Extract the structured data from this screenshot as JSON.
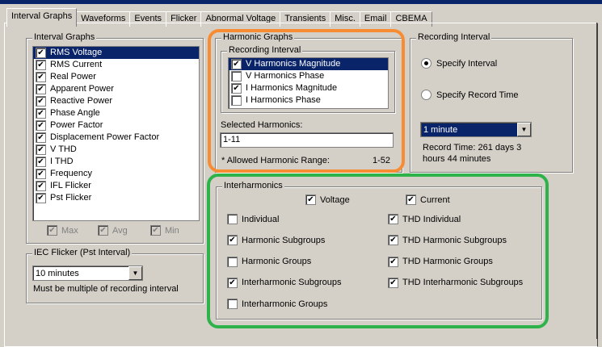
{
  "tabs": [
    "Interval Graphs",
    "Waveforms",
    "Events",
    "Flicker",
    "Abnormal Voltage",
    "Transients",
    "Misc.",
    "Email",
    "CBEMA"
  ],
  "interval_graphs": {
    "title": "Interval Graphs",
    "items": [
      {
        "label": "RMS Voltage",
        "checked": true,
        "selected": true
      },
      {
        "label": "RMS Current",
        "checked": true
      },
      {
        "label": "Real Power",
        "checked": true
      },
      {
        "label": "Apparent Power",
        "checked": true
      },
      {
        "label": "Reactive Power",
        "checked": true
      },
      {
        "label": "Phase Angle",
        "checked": true
      },
      {
        "label": "Power Factor",
        "checked": true
      },
      {
        "label": "Displacement Power Factor",
        "checked": true
      },
      {
        "label": "V THD",
        "checked": true
      },
      {
        "label": "I THD",
        "checked": true
      },
      {
        "label": "Frequency",
        "checked": true
      },
      {
        "label": "IFL Flicker",
        "checked": true
      },
      {
        "label": "Pst Flicker",
        "checked": true
      }
    ],
    "max": "Max",
    "avg": "Avg",
    "min": "Min"
  },
  "iec": {
    "title": "IEC Flicker (Pst Interval)",
    "value": "10 minutes",
    "note": "Must be multiple of recording interval"
  },
  "harmonic": {
    "title": "Harmonic Graphs",
    "sub_title": "Recording Interval",
    "items": [
      {
        "label": "V Harmonics Magnitude",
        "checked": true,
        "selected": true
      },
      {
        "label": "V Harmonics Phase",
        "checked": false
      },
      {
        "label": "I Harmonics Magnitude",
        "checked": true
      },
      {
        "label": "I Harmonics Phase",
        "checked": false
      }
    ],
    "selected_label": "Selected Harmonics:",
    "selected_value": "1-11",
    "allowed_label": "* Allowed Harmonic Range:",
    "allowed_value": "1-52"
  },
  "recording": {
    "title": "Recording Interval",
    "specify_interval": "Specify Interval",
    "specify_time": "Specify Record Time",
    "interval_value": "1 minute",
    "record_time_1": "Record Time: 261 days 3",
    "record_time_2": "hours 44 minutes"
  },
  "inter": {
    "title": "Interharmonics",
    "voltage": "Voltage",
    "current": "Current",
    "left": [
      {
        "label": "Individual",
        "checked": false
      },
      {
        "label": "Harmonic Subgroups",
        "checked": true
      },
      {
        "label": "Harmonic Groups",
        "checked": false
      },
      {
        "label": "Interharmonic Subgroups",
        "checked": true
      },
      {
        "label": "Interharmonic Groups",
        "checked": false
      }
    ],
    "right": [
      {
        "label": "THD Individual",
        "checked": true
      },
      {
        "label": "THD Harmonic Subgroups",
        "checked": true
      },
      {
        "label": "THD Harmonic Groups",
        "checked": true
      },
      {
        "label": "THD Interharmonic Subgroups",
        "checked": true
      }
    ]
  },
  "highlight_colors": {
    "orange": "#f78c33",
    "green": "#2db34a"
  }
}
